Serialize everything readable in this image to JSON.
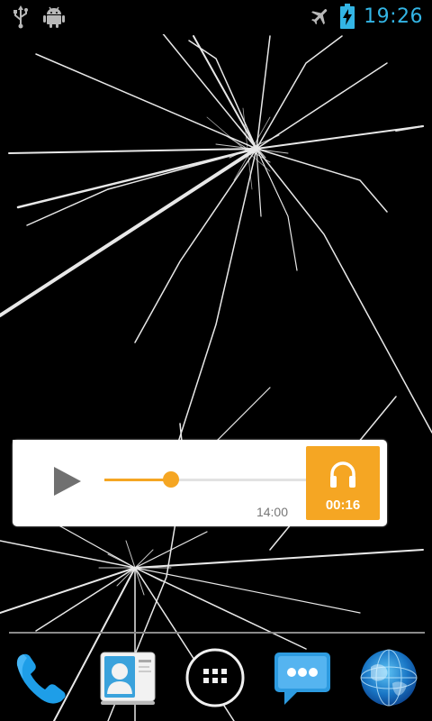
{
  "status_bar": {
    "icons_left": [
      "usb-icon",
      "android-debug-icon"
    ],
    "icons_right": [
      "airplane-mode-icon",
      "battery-charging-icon"
    ],
    "time": "19:26"
  },
  "widget": {
    "play_icon": "play-icon",
    "progress": 0.32,
    "duration": "14:00",
    "headphone_icon": "headphones-icon",
    "elapsed": "00:16",
    "accent_color": "#f5a623"
  },
  "dock": {
    "items": [
      "phone-icon",
      "contacts-icon",
      "app-drawer-icon",
      "messaging-icon",
      "browser-icon"
    ]
  },
  "colors": {
    "clock": "#33b5e5",
    "background": "#000000"
  }
}
